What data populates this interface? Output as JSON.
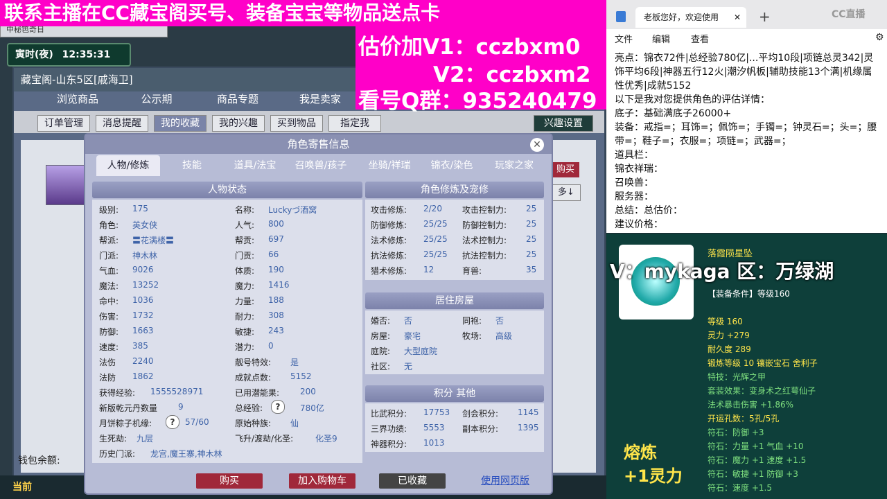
{
  "promo": {
    "top_line": "联系主播在CC藏宝阁买号、装备宝宝等物品送点卡",
    "lines": [
      "估价加V1：cczbxm0",
      "V2：cczbxm2",
      "看号Q群：935240479"
    ]
  },
  "game": {
    "tab_title": "中秘笆奇日",
    "time_label": "寅时(夜)",
    "time": "12:35:31",
    "window_title": "藏宝阁-山东5区[戚海卫]",
    "nav_tabs": [
      "浏览商品",
      "公示期",
      "商品专题",
      "我是卖家",
      "我"
    ],
    "sub_buttons": [
      "订单管理",
      "消息提醒",
      "我的收藏",
      "我的兴趣",
      "买到物品",
      "指定我"
    ],
    "interest_button": "兴趣设置",
    "buy_side": "购买",
    "more_side": "多↓",
    "wallet_label": "钱包余额:",
    "now_label": "当前"
  },
  "dialog": {
    "title": "角色寄售信息",
    "tabs": [
      "人物/修炼",
      "技能",
      "道具/法宝",
      "召唤兽/孩子",
      "坐骑/祥瑞",
      "锦衣/染色",
      "玩家之家"
    ],
    "status_head": "人物状态",
    "status_left": [
      {
        "k": "级别:",
        "v": "175"
      },
      {
        "k": "角色:",
        "v": "英女侠"
      },
      {
        "k": "帮派:",
        "v": "〓花满楼〓"
      },
      {
        "k": "门派:",
        "v": "神木林"
      },
      {
        "k": "气血:",
        "v": "9026"
      },
      {
        "k": "魔法:",
        "v": "13252"
      },
      {
        "k": "命中:",
        "v": "1036"
      },
      {
        "k": "伤害:",
        "v": "1732"
      },
      {
        "k": "防御:",
        "v": "1663"
      },
      {
        "k": "速度:",
        "v": "385"
      },
      {
        "k": "法伤",
        "v": "2240"
      },
      {
        "k": "法防",
        "v": "1862"
      },
      {
        "k": "获得经验:",
        "v": "1555528971"
      },
      {
        "k": "新版乾元丹数量",
        "v": "9"
      },
      {
        "k": "月饼粽子机缘:",
        "v": "57/60"
      },
      {
        "k": "生死劫:",
        "v": "九层"
      },
      {
        "k": "历史门派:",
        "v": "龙宫,魔王寨,神木林"
      }
    ],
    "status_right": [
      {
        "k": "名称:",
        "v": "Luckyづ酒窝"
      },
      {
        "k": "人气:",
        "v": "800"
      },
      {
        "k": "帮贡:",
        "v": "697"
      },
      {
        "k": "门贡:",
        "v": "66"
      },
      {
        "k": "体质:",
        "v": "190"
      },
      {
        "k": "魔力:",
        "v": "1416"
      },
      {
        "k": "力量:",
        "v": "188"
      },
      {
        "k": "耐力:",
        "v": "308"
      },
      {
        "k": "敏捷:",
        "v": "243"
      },
      {
        "k": "潜力:",
        "v": "0"
      },
      {
        "k": "靓号特效:",
        "v": "是"
      },
      {
        "k": "成就点数:",
        "v": "5152"
      },
      {
        "k": "已用潜能果:",
        "v": "200"
      },
      {
        "k": "总经验:",
        "v": "780亿"
      },
      {
        "k": "原始种族:",
        "v": "仙"
      },
      {
        "k": "飞升/渡劫/化圣:",
        "v": "化圣9"
      }
    ],
    "cultivation_head": "角色修炼及宠修",
    "cultivation": [
      {
        "k": "攻击修炼:",
        "v": "2/20",
        "k2": "攻击控制力:",
        "v2": "25"
      },
      {
        "k": "防御修炼:",
        "v": "25/25",
        "k2": "防御控制力:",
        "v2": "25"
      },
      {
        "k": "法术修炼:",
        "v": "25/25",
        "k2": "法术控制力:",
        "v2": "25"
      },
      {
        "k": "抗法修炼:",
        "v": "25/25",
        "k2": "抗法控制力:",
        "v2": "25"
      },
      {
        "k": "猎术修炼:",
        "v": "12",
        "k2": "育兽:",
        "v2": "35"
      }
    ],
    "house_head": "居住房屋",
    "house": [
      {
        "k": "婚否:",
        "v": "否",
        "k2": "同袍:",
        "v2": "否"
      },
      {
        "k": "房屋:",
        "v": "豪宅",
        "k2": "牧场:",
        "v2": "高级"
      },
      {
        "k": "庭院:",
        "v": "大型庭院",
        "k2": "",
        "v2": ""
      },
      {
        "k": "社区:",
        "v": "无",
        "k2": "",
        "v2": ""
      }
    ],
    "score_head": "积分 其他",
    "score": [
      {
        "k": "比武积分:",
        "v": "17753",
        "k2": "剑会积分:",
        "v2": "1145"
      },
      {
        "k": "三界功绩:",
        "v": "5553",
        "k2": "副本积分:",
        "v2": "1395"
      },
      {
        "k": "神器积分:",
        "v": "1013",
        "k2": "",
        "v2": ""
      }
    ],
    "buttons": {
      "buy": "购买",
      "cart": "加入购物车",
      "collected": "已收藏",
      "web": "使用网页版"
    }
  },
  "browser": {
    "tab_title": "老板您好，欢迎使用",
    "menu": [
      "文件",
      "编辑",
      "查看"
    ],
    "lines": [
      "亮点：锦衣72件|总经验780亿|...平均10段|项链总灵342|灵",
      "饰平均6段|神器五行12火|潮汐帆板|辅助技能13个满|机缘属",
      "性优秀|成就5152",
      "以下是我对您提供角色的评估详情：",
      "底子：基础满底子26000+",
      "装备：戒指=；耳饰=；佩饰=；手镯=；钟灵石=；头=；腰",
      "带=；鞋子=；衣服=；项链=；武器=；",
      "道具栏：",
      "锦衣祥瑞：",
      "召唤兽：",
      "服务器：",
      "总结：总估价：",
      "建议价格："
    ],
    "logo": "CC直播"
  },
  "item": {
    "name": "落霞陨星坠",
    "banner": "V：mykaga  区：万绿湖",
    "req": "【装备条件】等级160",
    "stats": [
      {
        "t": "等级 160",
        "c": "#ffe54a"
      },
      {
        "t": "灵力 +279",
        "c": "#ffe54a"
      },
      {
        "t": "耐久度 289",
        "c": "#ffe54a"
      },
      {
        "t": "锻炼等级 10  镶嵌宝石 舍利子",
        "c": "#ffe54a"
      },
      {
        "t": "特技：光辉之甲",
        "c": "#7fe07f"
      },
      {
        "t": "套装效果：变身术之红萼仙子",
        "c": "#7fe07f"
      },
      {
        "t": "法术暴击伤害 +1.86%",
        "c": "#7fe07f"
      },
      {
        "t": "开运孔数：5孔/5孔",
        "c": "#ffe54a"
      },
      {
        "t": "符石：防御 +3",
        "c": "#7fe07f"
      },
      {
        "t": "符石：力量 +1 气血 +10",
        "c": "#7fe07f"
      },
      {
        "t": "符石：魔力 +1 速度 +1.5",
        "c": "#7fe07f"
      },
      {
        "t": "符石：敏捷 +1 防御 +3",
        "c": "#7fe07f"
      },
      {
        "t": "符石：速度 +1.5",
        "c": "#7fe07f"
      }
    ],
    "melt": "熔炼",
    "melt_value": "+1灵力"
  }
}
